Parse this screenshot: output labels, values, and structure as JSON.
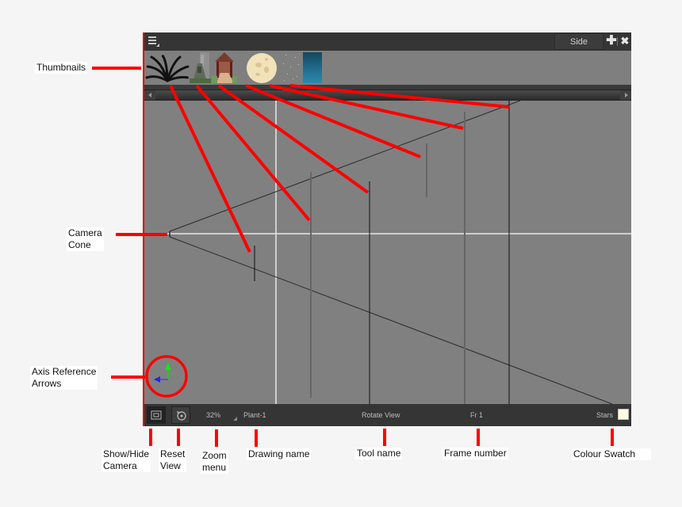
{
  "panel": {
    "title_tab": "Side",
    "menu_icon": "hamburger-menu-icon",
    "add_icon": "plus-icon",
    "close_icon": "close-icon",
    "add_glyph": "✚",
    "close_glyph": "✖",
    "accent_border_color": "#dd0000"
  },
  "thumbnails": [
    {
      "name": "palm-plant",
      "desc": "dark palm leaves"
    },
    {
      "name": "tower-building",
      "desc": "tall stone tower"
    },
    {
      "name": "gazebo-path",
      "desc": "pavilion with path"
    },
    {
      "name": "moon",
      "desc": "cream moon"
    },
    {
      "name": "stars",
      "desc": "scattered stars"
    },
    {
      "name": "sky-gradient",
      "desc": "blue sky"
    }
  ],
  "statusbar": {
    "show_hide_camera_icon": "camera-frame-icon",
    "reset_view_icon": "reset-rotate-icon",
    "zoom": "32%",
    "drawing_name": "Plant-1",
    "tool_name": "Rotate View",
    "frame": "Fr 1",
    "layer_name": "Stars",
    "colour_swatch": "#fffbe0"
  },
  "annotations": {
    "thumbnails": "Thumbnails",
    "camera_cone_line1": "Camera",
    "camera_cone_line2": "Cone",
    "axis_line1": "Axis Reference",
    "axis_line2": "Arrows",
    "show_hide_line1": "Show/Hide",
    "show_hide_line2": "Camera",
    "reset_line1": "Reset",
    "reset_line2": "View",
    "zoom_line1": "Zoom",
    "zoom_line2": "menu",
    "drawing_name": "Drawing name",
    "tool_name": "Tool name",
    "frame_number": "Frame number",
    "colour_swatch": "Colour Swatch",
    "annotation_color": "#ff0000"
  }
}
